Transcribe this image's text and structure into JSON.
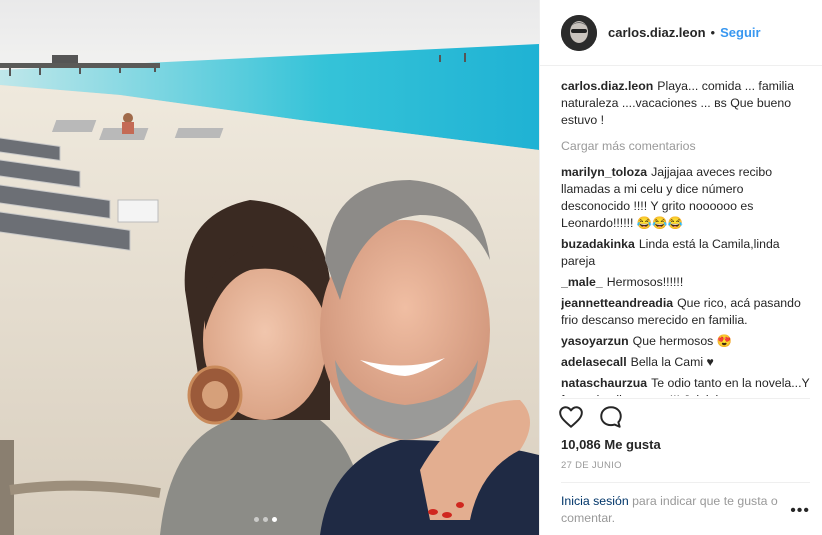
{
  "post": {
    "username": "carlos.diaz.leon",
    "separator": "•",
    "follow_label": "Seguir",
    "caption": "Playa... comida ... familia naturaleza ....vacaciones ... ʙs Que bueno estuvo !",
    "load_more_label": "Cargar más comentarios",
    "comments": [
      {
        "author": "marilyn_toloza",
        "text": "Jajjajaa aveces recibo llamadas a mi celu y dice número desconocido !!!! Y grito noooooo es Leonardo!!!!!! 😂😂😂"
      },
      {
        "author": "buzadakinka",
        "text": "Linda está la Camila,linda pareja"
      },
      {
        "author": "_male_",
        "text": "Hermosos!!!!!!"
      },
      {
        "author": "jeannetteandreadia",
        "text": "Que rico, acá pasando frio descanso merecido en familia."
      },
      {
        "author": "yasoyarzun",
        "text": "Que hermosos 😍"
      },
      {
        "author": "adelasecall",
        "text": "Bella la Cami ♥"
      },
      {
        "author": "nataschaurzua",
        "text": "Te odio tanto en la novela...Y fuera de ella te amo!!! Jajajaj"
      }
    ],
    "likes_label": "10,086 Me gusta",
    "date_label": "27 DE JUNIO",
    "login_link": "Inicia sesión",
    "login_text": " para indicar que te gusta o comentar.",
    "more_label": "•••",
    "carousel": {
      "count": 3,
      "active_index": 2
    }
  },
  "icons": {
    "like": "heart-icon",
    "comment": "comment-bubble-icon",
    "more": "more-options-icon"
  },
  "colors": {
    "link_blue": "#3897f0",
    "login_link": "#003569",
    "muted": "#999999",
    "text": "#262626"
  }
}
